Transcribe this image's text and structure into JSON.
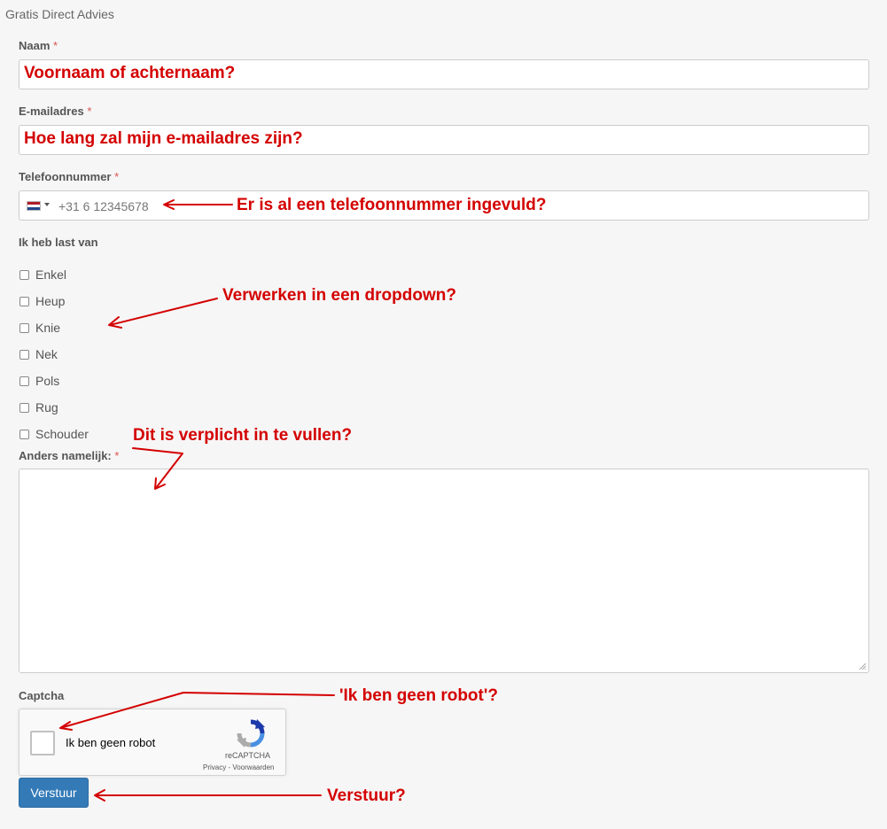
{
  "heading": "Gratis Direct Advies",
  "fields": {
    "naam": {
      "label": "Naam",
      "required": "*",
      "annotation": "Voornaam of achternaam?"
    },
    "email": {
      "label": "E-mailadres",
      "required": "*",
      "annotation": "Hoe lang zal mijn e-mailadres zijn?"
    },
    "telefoon": {
      "label": "Telefoonnummer",
      "required": "*",
      "value": "+31 6 12345678",
      "annotation": "Er is al een telefoonnummer ingevuld?"
    },
    "complaints": {
      "label": "Ik heb last van",
      "annotation": "Verwerken in een dropdown?",
      "options": [
        "Enkel",
        "Heup",
        "Knie",
        "Nek",
        "Pols",
        "Rug",
        "Schouder"
      ]
    },
    "anders": {
      "label": "Anders namelijk:",
      "required": "*",
      "annotation": "Dit is verplicht in te vullen?"
    },
    "captcha": {
      "label": "Captcha",
      "checkbox_label": "Ik ben geen robot",
      "brand": "reCAPTCHA",
      "links": "Privacy - Voorwaarden",
      "annotation": "'Ik ben geen robot'?"
    }
  },
  "submit": {
    "label": "Verstuur",
    "annotation": "Verstuur?"
  },
  "colors": {
    "annotation": "#d40000",
    "button": "#337ab7",
    "required": "#d9534f"
  }
}
